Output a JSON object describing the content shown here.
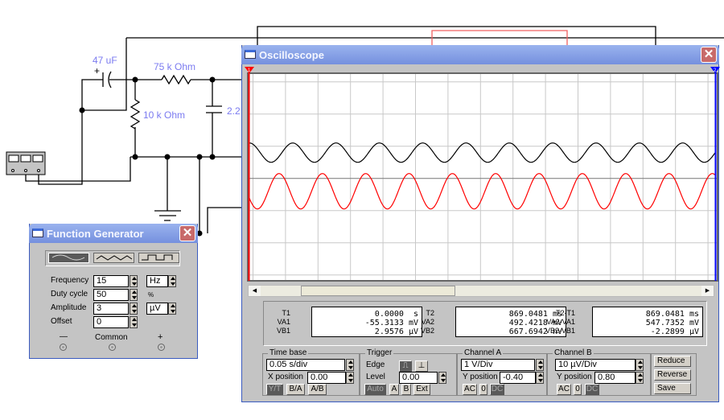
{
  "circuit": {
    "labels": {
      "c1": "47 uF",
      "r1": "75 k Ohm",
      "r2": "10 k Ohm",
      "c2": "2.2"
    },
    "label_color": "#7b7bf0"
  },
  "oscilloscope": {
    "title": "Oscilloscope",
    "cursor1": "1",
    "cursor2": "2",
    "waveforms": {
      "channel_a": {
        "color": "#ff0000",
        "freq_hz": 15,
        "vpp_div": 1.1,
        "offset_div": -0.4
      },
      "channel_b": {
        "color": "#000000",
        "freq_hz": 15,
        "vpp_div": 0.6,
        "offset_div": 0.8
      },
      "time_div_s": 0.05
    },
    "scrollbar": {
      "position_pct": 19,
      "thumb_pct": 35
    },
    "readouts": {
      "c1": {
        "labels": [
          "T1",
          "VA1",
          "VB1"
        ],
        "values": [
          "  0.0000  s",
          "-55.3133 mV",
          "  2.9576 µV"
        ]
      },
      "c2": {
        "labels": [
          "T2",
          "VA2",
          "VB2"
        ],
        "values": [
          "869.0481 ms",
          "492.4218 mV",
          "667.6942 nV"
        ]
      },
      "c3": {
        "labels": [
          "T2-T1",
          "VA2-VA1",
          "VB2-VB1"
        ],
        "values": [
          "869.0481 ms",
          "547.7352 mV",
          " -2.2899 µV"
        ]
      }
    },
    "timebase": {
      "title": "Time base",
      "scale": "0.05 s/div",
      "xpos_label": "X position",
      "xpos": "0.00",
      "modes": [
        "Y/T",
        "B/A",
        "A/B"
      ]
    },
    "trigger": {
      "title": "Trigger",
      "edge_label": "Edge",
      "level_label": "Level",
      "level": "0.00",
      "sources": [
        "Auto",
        "A",
        "B",
        "Ext"
      ]
    },
    "channel_a": {
      "title": "Channel A",
      "scale": " 1  V/Div",
      "ypos_label": "Y position",
      "ypos": "-0.40",
      "coupling": [
        "AC",
        "0",
        "DC"
      ]
    },
    "channel_b": {
      "title": "Channel B",
      "scale": "10 µV/Div",
      "ypos_label": "Y position",
      "ypos": "0.80",
      "coupling": [
        "AC",
        "0",
        "DC"
      ]
    },
    "buttons": {
      "reduce": "Reduce",
      "reverse": "Reverse",
      "save": "Save"
    }
  },
  "function_generator": {
    "title": "Function Generator",
    "frequency_label": "Frequency",
    "frequency": "15",
    "frequency_unit": "Hz",
    "duty_label": "Duty cycle",
    "duty": "50",
    "duty_unit": "%",
    "amplitude_label": "Amplitude",
    "amplitude": "3",
    "amplitude_unit": "µV",
    "offset_label": "Offset",
    "offset": "0",
    "terminals": [
      "—",
      "Common",
      "+"
    ]
  }
}
